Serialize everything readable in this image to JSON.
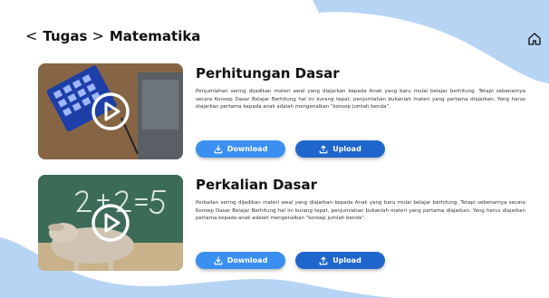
{
  "breadcrumb": {
    "items": [
      "Tugas",
      "Matematika"
    ]
  },
  "header": {
    "home_icon": "home-icon"
  },
  "colors": {
    "accent": "#3a8ff0",
    "accent_dark": "#1f66cc",
    "wave": "#b7d4f5"
  },
  "lessons": [
    {
      "title": "Perhitungan Dasar",
      "description": "Penjumlahan sering dijadikan materi awal yang diajarkan kepada Anak yang baru mulai belajar berhitung. Tetapi sebenarnya secara Konsep Dasar Belajar Berhitung hal ini kurang tepat, penjumlahan bukanlah materi yang pertama diajarkan. Yang harus diajarkan pertama kepada anak adalah mengenalkan \"konsep jumlah benda\".",
      "download_label": "Download",
      "upload_label": "Upload"
    },
    {
      "title": "Perkalian Dasar",
      "description": "Perkalian sering dijadikan materi awal yang diajarkan kepada Anak yang baru mulai belajar berhitung. Tetapi sebenarnya secara Konsep Dasar Belajar Berhitung hal ini kurang tepat, penjumlahan bukanlah materi yang pertama diajarkan. Yang harus diajarkan pertama kepada anak adalah mengenalkan \"konsep jumlah benda\".",
      "download_label": "Download",
      "upload_label": "Upload"
    }
  ]
}
